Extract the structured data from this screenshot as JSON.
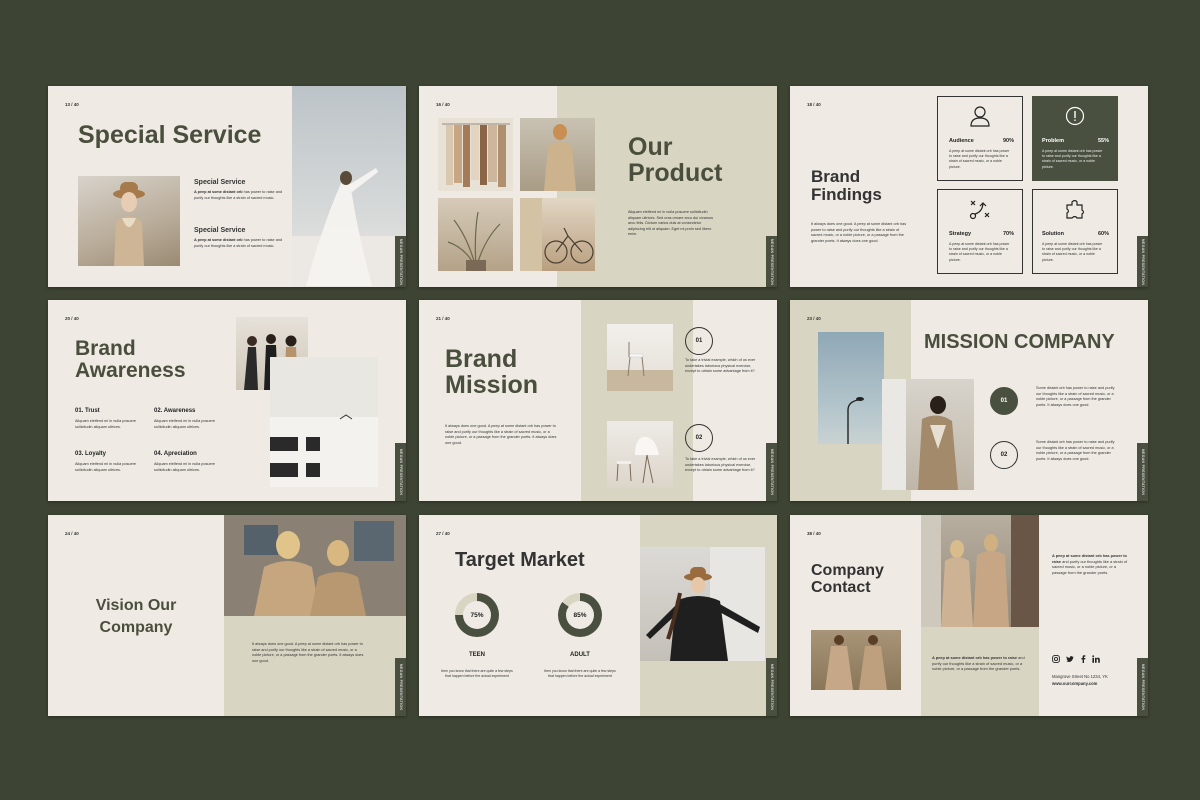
{
  "side_label": "MEGAN PRESENTATION",
  "slides": {
    "s1": {
      "page": "13 / 40",
      "title": "Special Service",
      "items": [
        {
          "heading": "Special Service",
          "lead": "A peep at some distant orb",
          "text": " has power to raise and purify our thoughts like a strain of sacred music."
        },
        {
          "heading": "Special Service",
          "lead": "A peep at some distant orb",
          "text": " has power to raise and purify our thoughts like a strain of sacred music."
        }
      ]
    },
    "s2": {
      "page": "16 / 40",
      "title_line1": "Our",
      "title_line2": "Product",
      "text": "Aliquam eleifend mi in nulla posuere sollicitudin aliquam ultrices. Sed cras ornare arcu dui vivamus arcu felis. Dictum varius duis at consectetur adipiscing elit ut aliquam. Eget mi proin sed libero enim."
    },
    "s3": {
      "page": "18 / 40",
      "title_line1": "Brand",
      "title_line2": "Findings",
      "text": "It always does one good. A peep at some distant orb has power to raise and purify our thoughts like a strain of sacred music, or a noble picture, or a passage from the grander poets. It always does one good.",
      "cards": [
        {
          "label": "Audience",
          "pct": "90%",
          "text": "A peep at some distant orb has power to raise and purify our thoughts like a strain of sacred music, or a noble picture."
        },
        {
          "label": "Problem",
          "pct": "55%",
          "text": "A peep at some distant orb has power to raise and purify our thoughts like a strain of sacred music, or a noble picture."
        },
        {
          "label": "Strategy",
          "pct": "70%",
          "text": "A peep at some distant orb has power to raise and purify our thoughts like a strain of sacred music, or a noble picture."
        },
        {
          "label": "Solution",
          "pct": "60%",
          "text": "A peep at some distant orb has power to raise and purify our thoughts like a strain of sacred music, or a noble picture."
        }
      ]
    },
    "s4": {
      "page": "20 / 40",
      "title_line1": "Brand",
      "title_line2": "Awareness",
      "items": [
        {
          "label": "01. Trust",
          "text": "Aliquam eleifend mi in nulla posuere sollicitudin aliquam ultrices."
        },
        {
          "label": "02. Awareness",
          "text": "Aliquam eleifend mi in nulla posuere sollicitudin aliquam ultrices."
        },
        {
          "label": "03. Loyalty",
          "text": "Aliquam eleifend mi in nulla posuere sollicitudin aliquam ultrices."
        },
        {
          "label": "04. Apreciation",
          "text": "Aliquam eleifend mi in nulla posuere sollicitudin aliquam ultrices."
        }
      ]
    },
    "s5": {
      "page": "21 / 40",
      "title_line1": "Brand",
      "title_line2": "Mission",
      "text": "It always does one good. A peep at some distant orb has power to raise and purify our thoughts like a strain of sacred music, or a noble picture, or a passage from the grander poets. It always does one good.",
      "steps": [
        {
          "num": "01",
          "text": "To take a trivial example, which of us ever undertakes laborious physical exercise, except to obtain some advantage from it?"
        },
        {
          "num": "02",
          "text": "To take a trivial example, which of us ever undertakes laborious physical exercise, except to obtain some advantage from it?"
        }
      ]
    },
    "s6": {
      "page": "23 / 40",
      "title": "MISSION COMPANY",
      "steps": [
        {
          "num": "01",
          "text": "Some distant orb has power to raise and purify our thoughts like a strain of sacred music, or a noble picture, or a passage from the grander poets. It always does one good."
        },
        {
          "num": "02",
          "text": "Some distant orb has power to raise and purify our thoughts like a strain of sacred music, or a noble picture, or a passage from the grander poets. It always does one good."
        }
      ]
    },
    "s7": {
      "page": "24 / 40",
      "title_line1": "Vision Our",
      "title_line2": "Company",
      "text": "It always does one good. A peep at some distant orb has power to raise and purify our thoughts like a strain of sacred music, or a noble picture, or a passage from the grander poets. It always does one good."
    },
    "s8": {
      "page": "27 / 40",
      "title": "Target Market",
      "segments": [
        {
          "label": "TEEN",
          "pct_text": "75%",
          "value": 0.75,
          "text": "then you know that there are quite a few steps that happen before the actual experiment"
        },
        {
          "label": "ADULT",
          "pct_text": "85%",
          "value": 0.85,
          "text": "then you know that there are quite a few steps that happen before the actual experiment"
        }
      ]
    },
    "s9": {
      "page": "38 / 40",
      "title_line1": "Company",
      "title_line2": "Contact",
      "right_lead": "A peep at some distant orb has power to raise",
      "right_text": " and purify our thoughts like a strain of sacred music, or a noble picture, or a passage from the grander poets.",
      "box_lead": "A peep at some distant orb has power to raise",
      "box_text": " and purify our thoughts like a strain of sacred music, or a noble picture, or a passage from the grander poets.",
      "address": "Mangrove Street No 1234, YK",
      "website": "www.ourcompany.com"
    }
  },
  "colors": {
    "background": "#3e4433",
    "accent": "#4a5040",
    "khaki": "#d9d5c3",
    "slide": "#efebe4"
  }
}
